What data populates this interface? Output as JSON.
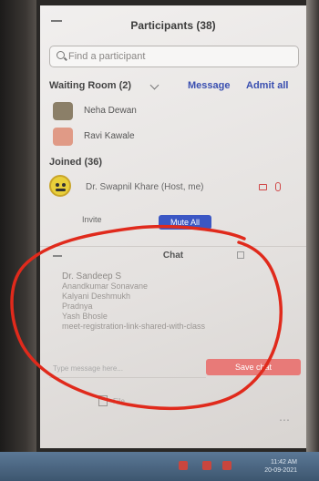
{
  "panel": {
    "title": "Participants (38)",
    "search_placeholder": "Find a participant"
  },
  "waiting_room": {
    "label": "Waiting Room (2)",
    "message_label": "Message",
    "admit_all_label": "Admit all",
    "people": [
      {
        "name": "Neha Dewan",
        "avatar_color": "#8b7f68"
      },
      {
        "name": "Ravi Kawale",
        "avatar_color": "#e09a86"
      }
    ]
  },
  "joined": {
    "label": "Joined (36)",
    "host_name": "Dr. Swapnil Khare (Host, me)"
  },
  "actions": {
    "invite_label": "Invite",
    "mute_all_label": "Mute All"
  },
  "chat": {
    "title": "Chat",
    "sender": "Dr. Sandeep S",
    "lines": [
      "Anandkumar Sonavane",
      "Kalyani Deshmukh",
      "Pradnya",
      "Yash Bhosle",
      "meet-registration-link-shared-with-class"
    ],
    "input_placeholder": "Type message here...",
    "save_label": "Save chat",
    "file_label": "File"
  },
  "taskbar": {
    "clock_time": "11:42 AM",
    "clock_date": "20-09-2021"
  }
}
